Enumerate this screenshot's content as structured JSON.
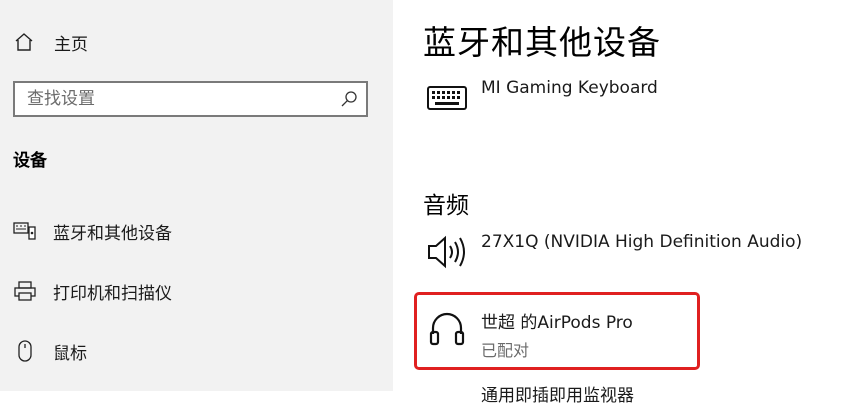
{
  "sidebar": {
    "home_label": "主页",
    "search_placeholder": "查找设置",
    "section_heading": "设备",
    "items": [
      {
        "label": "蓝牙和其他设备",
        "icon": "bluetooth-devices-icon"
      },
      {
        "label": "打印机和扫描仪",
        "icon": "printer-icon"
      },
      {
        "label": "鼠标",
        "icon": "mouse-icon"
      }
    ]
  },
  "main": {
    "title": "蓝牙和其他设备",
    "devices": [
      {
        "name": "MI Gaming Keyboard",
        "icon": "keyboard-icon"
      }
    ],
    "audio_heading": "音频",
    "audio_devices": [
      {
        "name": "27X1Q (NVIDIA High Definition Audio)",
        "icon": "speaker-icon"
      },
      {
        "name": "世超 的AirPods Pro",
        "status": "已配对",
        "icon": "headphones-icon"
      }
    ],
    "cut_off_text": "通用即插即用监视器"
  },
  "colors": {
    "sidebar_bg": "#f2f2f2",
    "highlight_border": "#e02020",
    "status_text": "#6b6b6b"
  }
}
